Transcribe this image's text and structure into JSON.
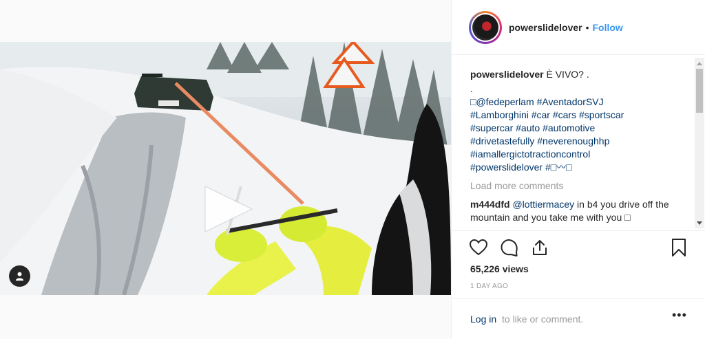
{
  "header": {
    "username": "powerslidelover",
    "separator": "•",
    "follow_label": "Follow"
  },
  "caption": {
    "username": "powerslidelover",
    "text": "È VIVO? .",
    "lines": [
      ".",
      "□@fedeperlam #AventadorSVJ",
      "#Lamborghini #car #cars #sportscar",
      "#supercar #auto #automotive",
      "#drivetastefully #neverenoughhp",
      "#iamallergictotractioncontrol",
      "#powerslidelover #□〰□"
    ]
  },
  "load_more": "Load more comments",
  "comment": {
    "username": "m444dfd",
    "mention": "@lottiermacey",
    "text": " in b4 you drive off the mountain and you take me with you □"
  },
  "icons": {
    "like": "heart-icon",
    "comment": "comment-icon",
    "share": "share-icon",
    "save": "bookmark-icon",
    "play": "play-icon",
    "profile": "user-icon",
    "more": "more-icon"
  },
  "views": "65,226 views",
  "time_ago": "1 DAY AGO",
  "login": {
    "link": "Log in",
    "rest": "to like or comment."
  },
  "more_label": "•••",
  "colors": {
    "link": "#003569",
    "follow": "#3897f0",
    "muted": "#999999",
    "text": "#262626"
  }
}
